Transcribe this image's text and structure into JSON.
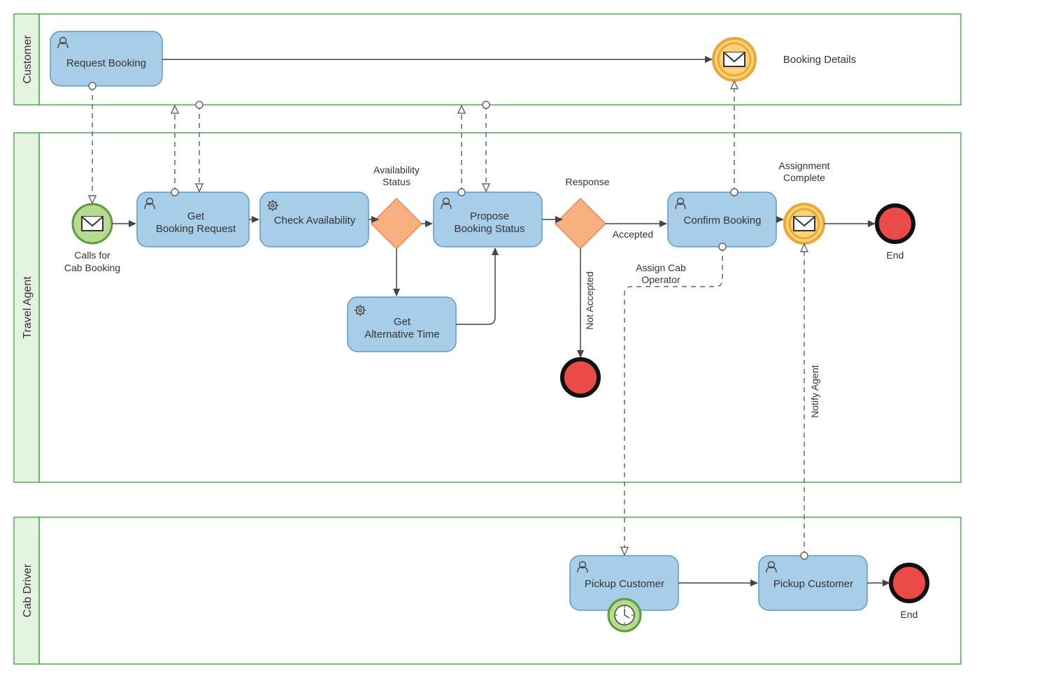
{
  "lanes": {
    "customer": "Customer",
    "agent": "Travel Agent",
    "driver": "Cab Driver"
  },
  "tasks": {
    "requestBooking": "Request Booking",
    "getBookingRequest1": "Get",
    "getBookingRequest2": "Booking Request",
    "checkAvailability": "Check Availability",
    "proposeStatus1": "Propose",
    "proposeStatus2": "Booking Status",
    "getAltTime1": "Get",
    "getAltTime2": "Alternative Time",
    "confirmBooking": "Confirm Booking",
    "pickupCustomer1": "Pickup Customer",
    "pickupCustomer2": "Pickup Customer"
  },
  "events": {
    "callsForCab1": "Calls for",
    "callsForCab2": "Cab Booking",
    "bookingDetails": "Booking Details",
    "assignmentComplete1": "Assignment",
    "assignmentComplete2": "Complete",
    "end1": "End",
    "end2": "End"
  },
  "gateways": {
    "availability1": "Availability",
    "availability2": "Status",
    "response": "Response"
  },
  "flowLabels": {
    "accepted": "Accepted",
    "notAccepted": "Not Accepted",
    "assignCab1": "Assign Cab",
    "assignCab2": "Operator",
    "notifyAgent": "Notify Agent"
  },
  "colors": {
    "laneGreen": "#4caf50",
    "laneFill": "#e4f4e0",
    "taskFill": "#a8cde8",
    "taskStroke": "#5c9bc7",
    "gatewayFill": "#f8b081",
    "startEventFill": "#b6da8f",
    "interEventFill": "#ffd27a",
    "endEventFill": "#ea4a48"
  }
}
